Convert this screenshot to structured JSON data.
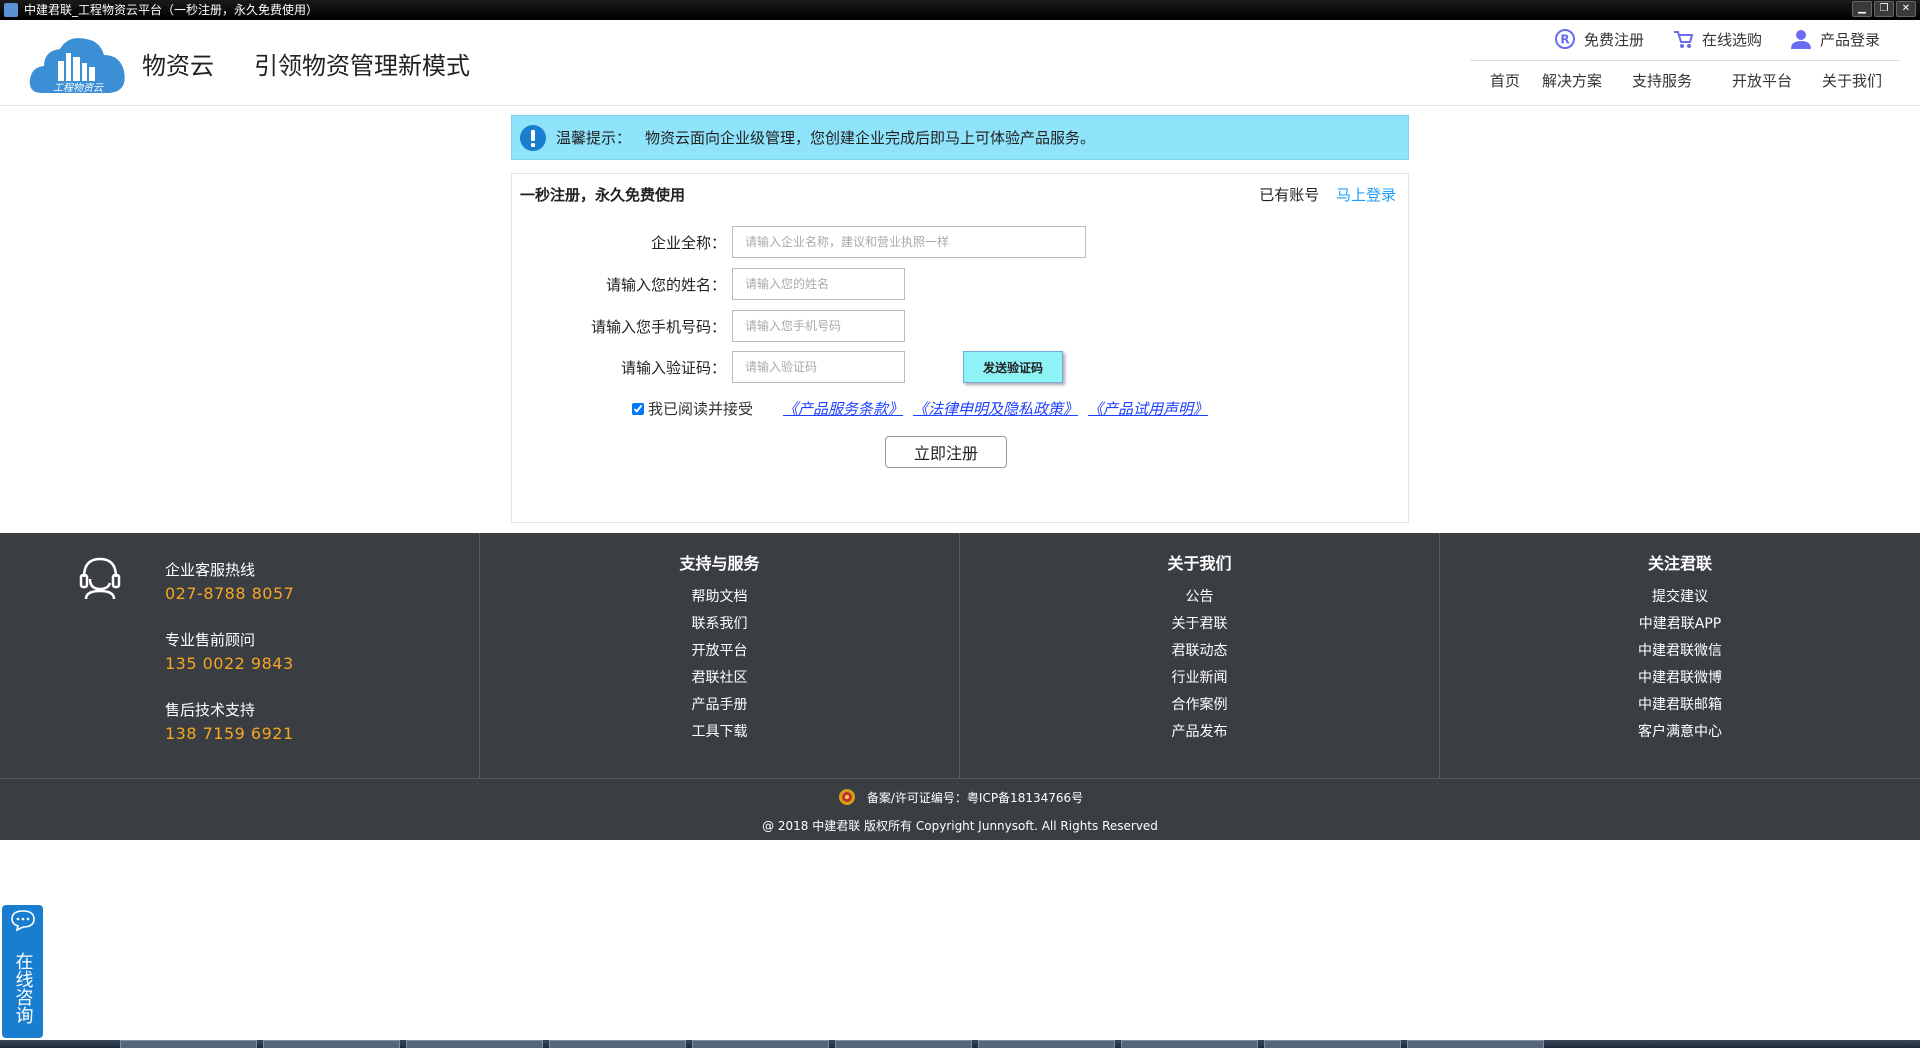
{
  "window": {
    "title": "中建君联_工程物资云平台（一秒注册，永久免费使用）",
    "controls": [
      "▁",
      "❐",
      "✕"
    ]
  },
  "header": {
    "logo_text": "工程物资云",
    "brand": "物资云",
    "slogan": "引领物资管理新模式",
    "top_links": [
      "免费注册",
      "在线选购",
      "产品登录"
    ],
    "nav": [
      "首页",
      "解决方案",
      "支持服务",
      "开放平台",
      "关于我们"
    ]
  },
  "notice": {
    "label": "温馨提示：",
    "text": "物资云面向企业级管理，您创建企业完成后即马上可体验产品服务。"
  },
  "form": {
    "title": "一秒注册，永久免费使用",
    "have_account": "已有账号",
    "login_link": "马上登录",
    "company": {
      "label": "企业全称：",
      "placeholder": "请输入企业名称，建议和营业执照一样",
      "value": ""
    },
    "name": {
      "label": "请输入您的姓名：",
      "placeholder": "请输入您的姓名",
      "value": ""
    },
    "phone": {
      "label": "请输入您手机号码：",
      "placeholder": "请输入您手机号码",
      "value": ""
    },
    "code": {
      "label": "请输入验证码：",
      "placeholder": "请输入验证码",
      "value": ""
    },
    "send_code": "发送验证码",
    "agree_text": "我已阅读并接受",
    "agree_checked": true,
    "policies": [
      "《产品服务条款》",
      "《法律申明及隐私政策》",
      "《产品试用声明》"
    ],
    "submit": "立即注册"
  },
  "footer": {
    "contacts": [
      {
        "title": "企业客服热线",
        "number": "027-8788 8057"
      },
      {
        "title": "专业售前顾问",
        "number": "135 0022 9843"
      },
      {
        "title": "售后技术支持",
        "number": "138 7159 6921"
      }
    ],
    "sections": [
      {
        "heading": "支持与服务",
        "items": [
          "帮助文档",
          "联系我们",
          "开放平台",
          "君联社区",
          "产品手册",
          "工具下载"
        ]
      },
      {
        "heading": "关于我们",
        "items": [
          "公告",
          "关于君联",
          "君联动态",
          "行业新闻",
          "合作案例",
          "产品发布"
        ]
      },
      {
        "heading": "关注君联",
        "items": [
          "提交建议",
          "中建君联APP",
          "中建君联微信",
          "中建君联微博",
          "中建君联邮箱",
          "客户满意中心"
        ]
      }
    ],
    "icp": "备案/许可证编号：粤ICP备18134766号",
    "copyright": "@ 2018 中建君联 版权所有 Copyright Junnysoft. All Rights Reserved"
  },
  "consult": {
    "label": "在线咨询"
  },
  "colors": {
    "notice_bg": "#8fe3fb",
    "footer_bg": "#3a3e42",
    "accent_orange": "#f5a623",
    "link_blue": "#1e9fff",
    "consult_bg": "#1a7ed0",
    "send_btn_bg": "#8ef3f7"
  },
  "icons": {
    "register": "registered-icon",
    "cart": "cart-icon",
    "user": "user-icon",
    "info": "info-icon",
    "headset": "headset-icon",
    "police": "police-badge-icon",
    "chat": "chat-bubble-icon"
  }
}
